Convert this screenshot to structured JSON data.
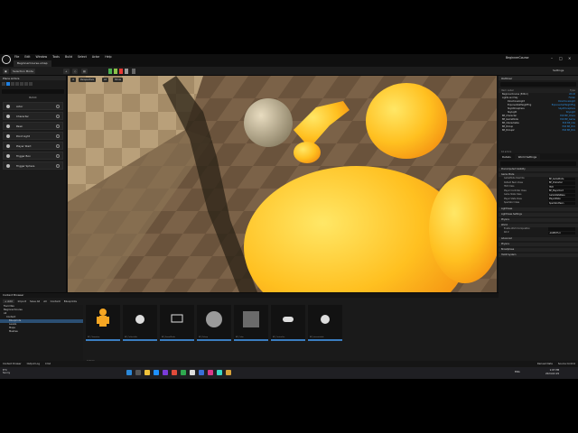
{
  "window": {
    "level_tab": "BeginnerCourse.umap",
    "project_name": "BeginnerCourse",
    "menu": [
      "File",
      "Edit",
      "Window",
      "Tools",
      "Build",
      "Select",
      "Actor",
      "Help"
    ]
  },
  "toolbar": {
    "mode": "Selection Mode",
    "settings": "Settings"
  },
  "place_actors": {
    "tab": "Place Actors",
    "category": "BASIC",
    "items": [
      "Actor",
      "Character",
      "Pawn",
      "Point Light",
      "Player Start",
      "Trigger Box",
      "Trigger Sphere"
    ]
  },
  "viewport": {
    "chips": [
      "Perspective",
      "Lit",
      "Show"
    ]
  },
  "outliner": {
    "tab": "Outliner",
    "columns": [
      "Item Label",
      "Type"
    ],
    "rows": [
      {
        "label": "BeginnerCourse (Editor)",
        "type": "World"
      },
      {
        "label": "Lights and Sky",
        "type": "Folder"
      },
      {
        "label": "DirectionalLight",
        "type": "DirectionalLight"
      },
      {
        "label": "ExponentialHeightFog",
        "type": "ExponentialHeightFog"
      },
      {
        "label": "SkyAtmosphere",
        "type": "SkyAtmosphere"
      },
      {
        "label": "SkyLight",
        "type": "SkyLight"
      },
      {
        "label": "BP_Character",
        "type": "Edit BP_Chara"
      },
      {
        "label": "BP_GameMode",
        "type": "Edit BP_Game"
      },
      {
        "label": "BP_Interactable",
        "type": "Edit BP_Inte"
      },
      {
        "label": "BP_Pickup",
        "type": "Edit BP_Pick"
      },
      {
        "label": "BP_Pickup2",
        "type": "Edit BP_Pick"
      }
    ],
    "footer": "16 actors"
  },
  "details": {
    "tabs": [
      "Details",
      "World Settings"
    ],
    "sections": [
      {
        "title": "Precomputed Visibility",
        "rows": []
      },
      {
        "title": "Game Mode",
        "rows": [
          {
            "label": "GameMode Override",
            "value": "BP_GameMode"
          },
          {
            "label": "Default Pawn Class",
            "value": "BP_Character"
          },
          {
            "label": "HUD Class",
            "value": "HUD"
          },
          {
            "label": "Player Controller Class",
            "value": "BP_PlayerCont"
          },
          {
            "label": "Game State Class",
            "value": "GameStateBase"
          },
          {
            "label": "Player State Class",
            "value": "PlayerState"
          },
          {
            "label": "Spectator Class",
            "value": "SpectatorPawn"
          }
        ]
      },
      {
        "title": "Lightmass",
        "rows": []
      },
      {
        "title": "Lightmass Settings",
        "rows": []
      },
      {
        "title": "Physics",
        "rows": []
      },
      {
        "title": "World",
        "rows": [
          {
            "label": "Enable World Composition",
            "value": ""
          },
          {
            "label": "Kill Z",
            "value": "-1048575.0"
          }
        ]
      },
      {
        "title": "Advanced",
        "rows": []
      },
      {
        "title": "Physics",
        "rows": []
      },
      {
        "title": "Broadphase",
        "rows": []
      },
      {
        "title": "HLOD System",
        "rows": []
      }
    ]
  },
  "content_browser": {
    "tab": "Content Browser",
    "add": "+ Add",
    "import": "Import",
    "save_all": "Save All",
    "path": [
      "All",
      "Content",
      "Blueprints"
    ],
    "favorites": "Favorites",
    "project": "BeginnerCourse",
    "tree": [
      "All",
      "Content",
      "Blueprints",
      "Levels",
      "Maps",
      "Meshes"
    ],
    "assets": [
      "BP_Character",
      "BP_Collectible",
      "BP_GameMode",
      "BP_Pickup",
      "BP_Cube",
      "BP_Controller",
      "BP_Interactable"
    ],
    "count": "7 items",
    "collections": "Collections"
  },
  "status": {
    "items": [
      "Content Drawer",
      "Output Log",
      "Cmd"
    ],
    "right": [
      "Derived Data",
      "Source Control"
    ]
  },
  "taskbar": {
    "temp": "8°C",
    "weather": "Sunny",
    "lang": "ENG",
    "time": "1:07 PM",
    "date": "2024-02-29"
  }
}
